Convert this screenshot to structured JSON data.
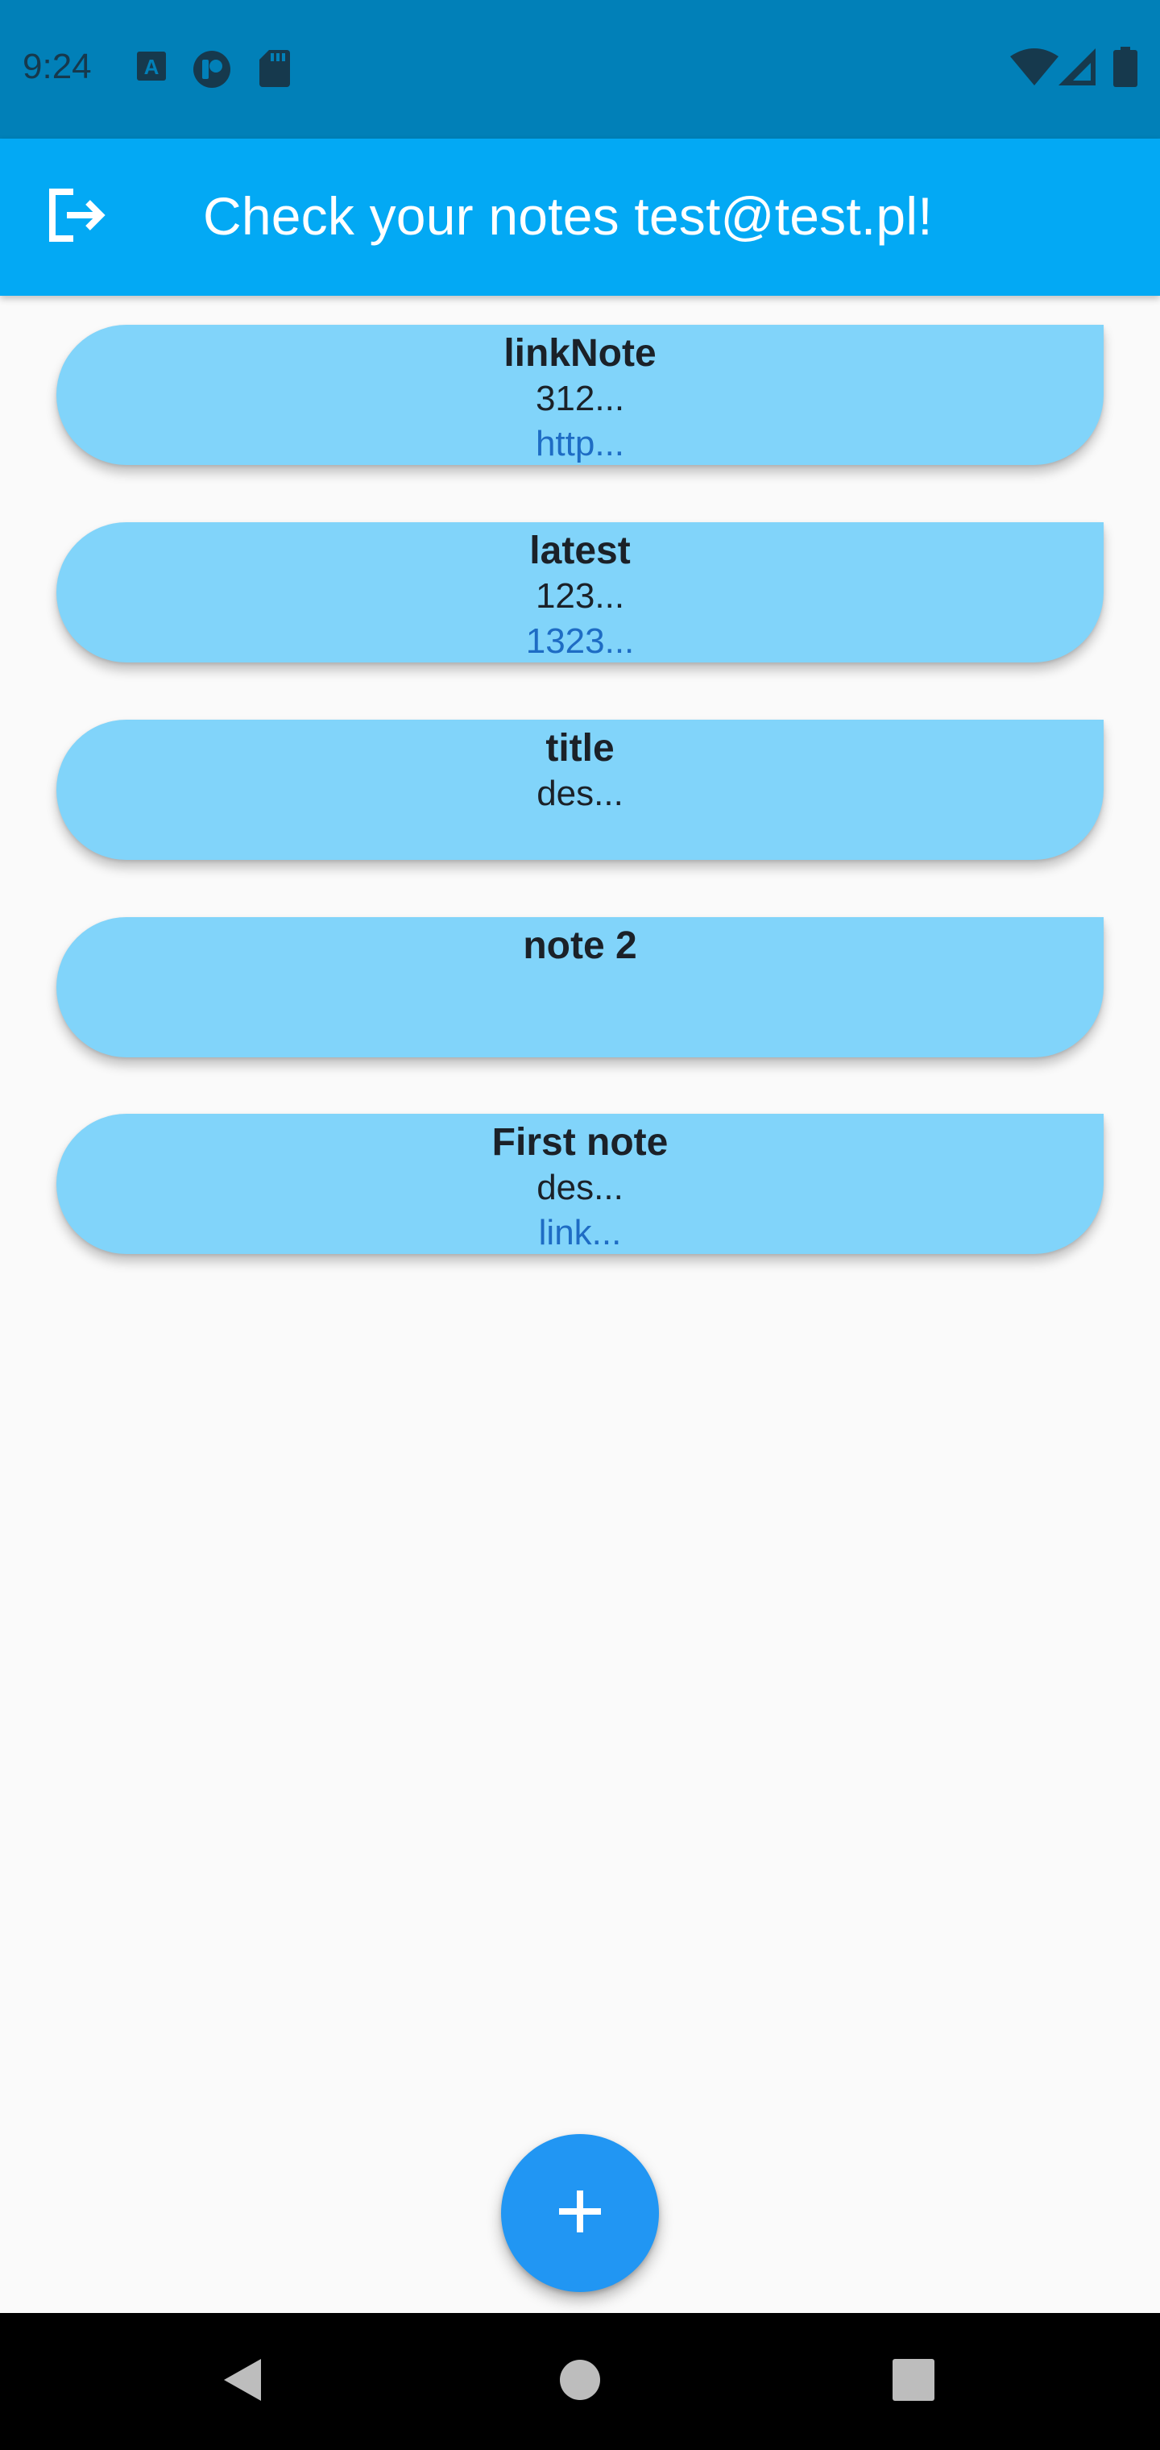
{
  "status_bar": {
    "time": "9:24",
    "icons_left": [
      "keyboard-a-icon",
      "app-circle-icon",
      "sd-card-icon"
    ],
    "icons_right": [
      "wifi-icon",
      "cell-signal-icon",
      "battery-icon"
    ]
  },
  "app_bar": {
    "title": "Check your notes test@test.pl!",
    "logout_icon": "logout-icon"
  },
  "notes": [
    {
      "title": "linkNote",
      "description": "312...",
      "link": "http..."
    },
    {
      "title": "latest",
      "description": "123...",
      "link": "1323..."
    },
    {
      "title": "title",
      "description": "des...",
      "link": ""
    },
    {
      "title": "note 2",
      "description": "",
      "link": ""
    },
    {
      "title": "First note",
      "description": "des...",
      "link": "link..."
    }
  ],
  "fab": {
    "icon": "plus-icon"
  },
  "nav_bar": {
    "buttons": [
      "back-icon",
      "home-icon",
      "recents-icon"
    ]
  },
  "colors": {
    "status_bar": "#0180b8",
    "app_bar": "#03a9f4",
    "card": "#81d4fa",
    "fab": "#2196f3",
    "link": "#1e6cc4",
    "background": "#fafafa"
  }
}
